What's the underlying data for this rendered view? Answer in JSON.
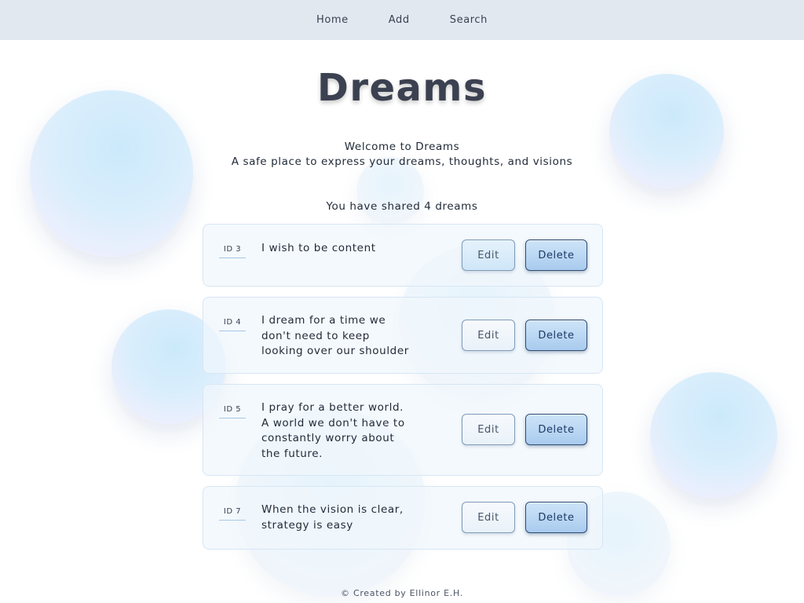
{
  "nav": {
    "items": [
      "Home",
      "Add",
      "Search"
    ]
  },
  "header": {
    "title": "Dreams",
    "welcome_line1": "Welcome to Dreams",
    "welcome_line2": "A safe place to express your dreams, thoughts, and visions"
  },
  "summary": {
    "count_text": "You have shared 4 dreams"
  },
  "dreams": [
    {
      "id_label": "ID 3",
      "text": "I wish to be content",
      "edit_label": "Edit",
      "delete_label": "Delete"
    },
    {
      "id_label": "ID 4",
      "text": "I dream for a time we don't need to keep looking over our shoulder",
      "edit_label": "Edit",
      "delete_label": "Delete"
    },
    {
      "id_label": "ID 5",
      "text": "I pray for a better world. A world we don't have to constantly worry about the future.",
      "edit_label": "Edit",
      "delete_label": "Delete"
    },
    {
      "id_label": "ID 7",
      "text": "When the vision is clear, strategy is easy",
      "edit_label": "Edit",
      "delete_label": "Delete"
    }
  ],
  "footer": {
    "text": "© Created by Ellinor E.H."
  },
  "colors": {
    "nav_background": "#e2e8f0",
    "title_text": "#3b4150",
    "delete_border": "#2f4c73",
    "bubble_blue": "#c9e8fb",
    "bubble_lavender": "#f3ecfb"
  }
}
